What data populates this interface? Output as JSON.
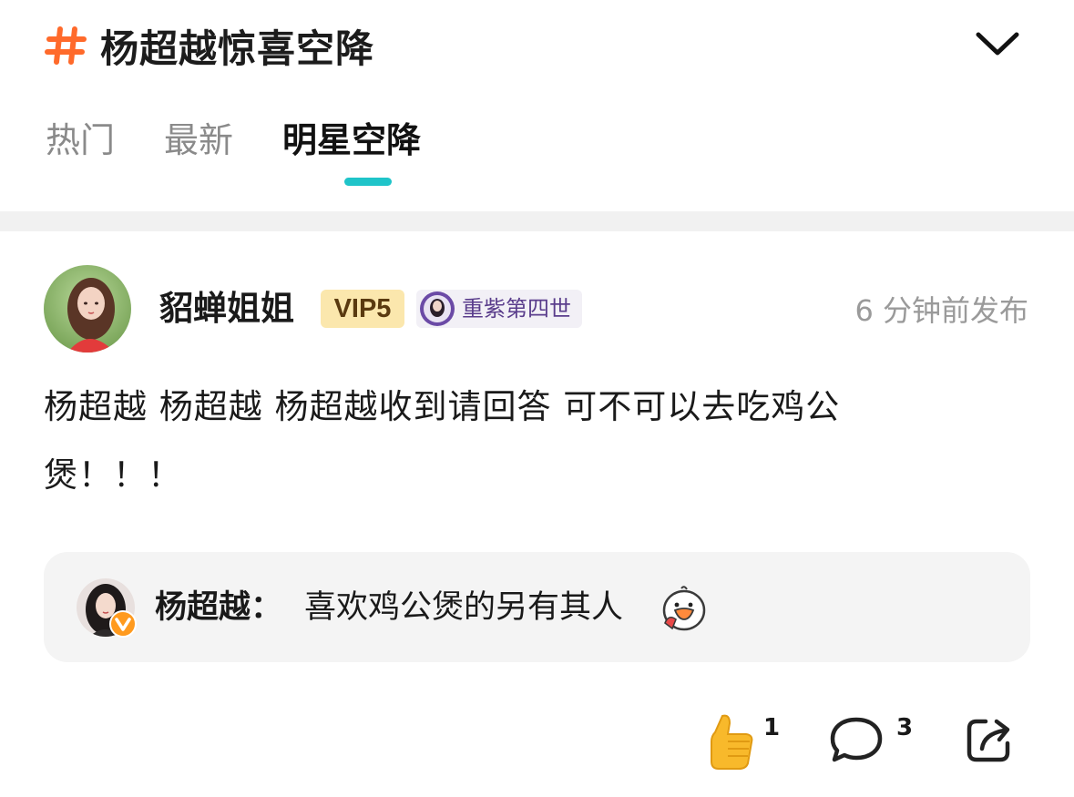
{
  "header": {
    "topic_title": "杨超越惊喜空降",
    "tabs": [
      {
        "label": "热门",
        "active": false
      },
      {
        "label": "最新",
        "active": false
      },
      {
        "label": "明星空降",
        "active": true
      }
    ],
    "accent_color": "#1fc4c9",
    "hash_icon": "hash-icon",
    "expand_icon": "chevron-down-icon"
  },
  "post": {
    "author": "貂蝉姐姐",
    "vip_badge": "VIP5",
    "medal_label": "重紫第四世",
    "time": "6 分钟前发布",
    "content_line1": "杨超越 杨超越 杨超越收到请回答 可不可以去吃鸡公",
    "content_line2": "煲！！！",
    "reply": {
      "name": "杨超越",
      "separator": "：",
      "text": "喜欢鸡公煲的另有其人",
      "emoji": "duck-emoji"
    },
    "actions": {
      "like_count": "1",
      "comment_count": "3",
      "like_icon": "thumbs-up-icon",
      "comment_icon": "comment-icon",
      "share_icon": "share-icon"
    }
  }
}
